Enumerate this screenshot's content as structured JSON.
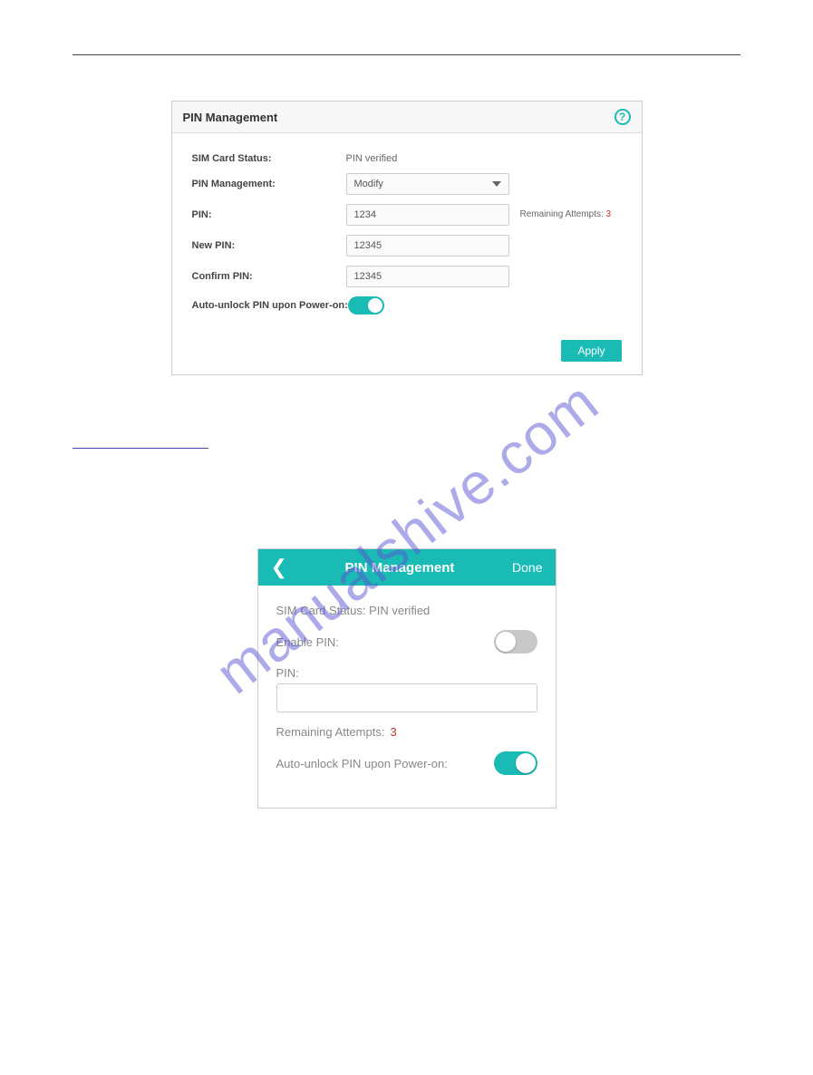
{
  "watermark": "manualshive.com",
  "desktop": {
    "title": "PIN Management",
    "fields": {
      "simStatusLabel": "SIM Card Status:",
      "simStatusValue": "PIN verified",
      "pinMgmtLabel": "PIN Management:",
      "pinMgmtValue": "Modify",
      "pinLabel": "PIN:",
      "pinValue": "1234",
      "remainingLabel": "Remaining Attempts:",
      "remainingValue": "3",
      "newPinLabel": "New PIN:",
      "newPinValue": "12345",
      "confirmPinLabel": "Confirm PIN:",
      "confirmPinValue": "12345",
      "autoUnlockLabel": "Auto-unlock PIN upon Power-on:"
    },
    "applyBtn": "Apply"
  },
  "mobile": {
    "title": "PIN Management",
    "doneBtn": "Done",
    "simStatusLine": "SIM Card Status: PIN verified",
    "enablePinLabel": "Enable PIN:",
    "pinLabel": "PIN:",
    "remainingLabel": "Remaining Attempts:",
    "remainingValue": "3",
    "autoUnlockLabel": "Auto-unlock PIN upon Power-on:"
  }
}
